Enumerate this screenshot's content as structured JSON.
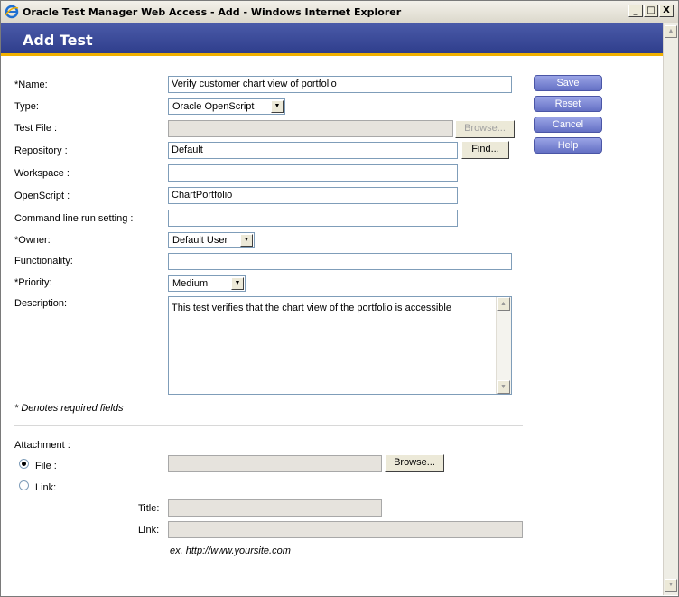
{
  "window": {
    "title": "Oracle Test Manager Web Access - Add - Windows Internet Explorer",
    "buttons": {
      "minimize": "_",
      "maximize": "□",
      "close": "X"
    }
  },
  "page": {
    "heading": "Add Test"
  },
  "form": {
    "name": {
      "label": "*Name:",
      "value": "Verify customer chart view of portfolio"
    },
    "type": {
      "label": "Type:",
      "value": "Oracle OpenScript"
    },
    "test_file": {
      "label": "Test File :",
      "value": "",
      "browse": "Browse..."
    },
    "repository": {
      "label": "Repository :",
      "value": "Default",
      "find": "Find..."
    },
    "workspace": {
      "label": "Workspace :",
      "value": ""
    },
    "openscript": {
      "label": "OpenScript :",
      "value": "ChartPortfolio"
    },
    "command_line": {
      "label": "Command line run setting :",
      "value": ""
    },
    "owner": {
      "label": "*Owner:",
      "value": "Default User"
    },
    "functionality": {
      "label": "Functionality:",
      "value": ""
    },
    "priority": {
      "label": "*Priority:",
      "value": "Medium"
    },
    "description": {
      "label": "Description:",
      "value": "This test verifies that the chart view of the portfolio is accessible"
    },
    "required_note": "* Denotes required fields"
  },
  "actions": {
    "save": "Save",
    "reset": "Reset",
    "cancel": "Cancel",
    "help": "Help"
  },
  "attachment": {
    "label": "Attachment :",
    "file_option": "File :",
    "link_option": "Link:",
    "selected": "File",
    "file_value": "",
    "browse": "Browse...",
    "title_label": "Title:",
    "title_value": "",
    "link_label": "Link:",
    "link_value": "",
    "example": "ex. http://www.yoursite.com"
  },
  "colors": {
    "header_bg": "#2f3e8c",
    "header_accent": "#f0b000",
    "side_button": "#6470c4"
  },
  "icons": [
    "ie-icon",
    "dropdown-arrow-icon",
    "scroll-up-icon",
    "scroll-down-icon"
  ]
}
